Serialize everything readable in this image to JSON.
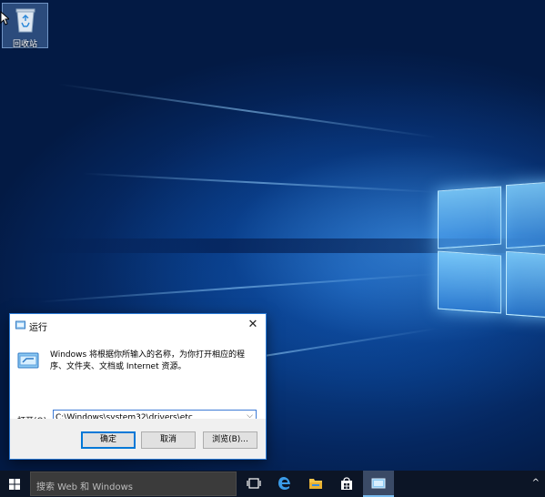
{
  "desktop": {
    "icons": [
      {
        "label": "回收站",
        "icon": "recycle-bin-icon"
      }
    ]
  },
  "run_dialog": {
    "title": "运行",
    "description": "Windows 将根据你所输入的名称，为你打开相应的程序、文件夹、文档或 Internet 资源。",
    "open_label": "打开(O):",
    "open_value": "C:\\Windows\\system32\\drivers\\etc",
    "ok_label": "确定",
    "cancel_label": "取消",
    "browse_label": "浏览(B)..."
  },
  "taskbar": {
    "search_placeholder": "搜索 Web 和 Windows",
    "buttons": [
      {
        "name": "task-view",
        "icon": "task-view-icon"
      },
      {
        "name": "edge",
        "icon": "edge-icon"
      },
      {
        "name": "file-explorer",
        "icon": "folder-icon"
      },
      {
        "name": "store",
        "icon": "store-icon"
      },
      {
        "name": "run",
        "icon": "run-icon",
        "active": true
      }
    ],
    "tray_chevron": "^"
  },
  "colors": {
    "accent": "#0078d7",
    "taskbar": "#0c1526",
    "dialog_border": "#2a7ad6"
  }
}
